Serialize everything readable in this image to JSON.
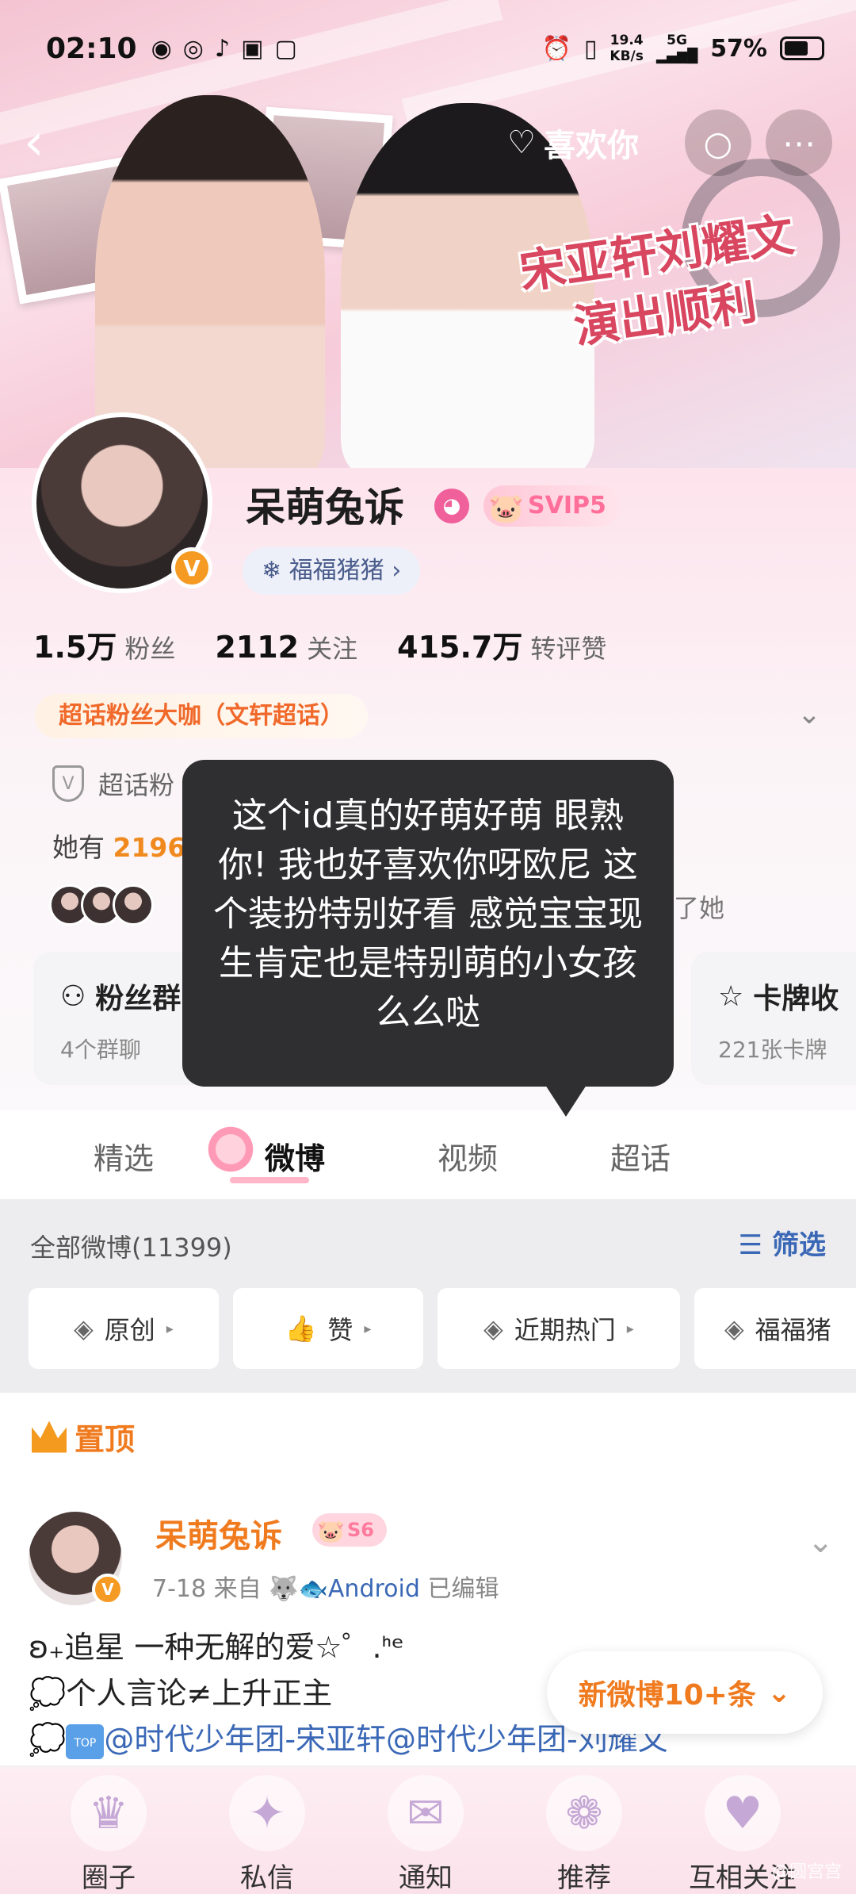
{
  "status_bar": {
    "time": "02:10",
    "net_speed": "19.4",
    "net_unit": "KB/s",
    "network": "5G",
    "battery": "57%"
  },
  "header": {
    "like_label": "喜欢你"
  },
  "banner": {
    "title_line1": "宋亚轩刘耀文",
    "title_line2": "演出顺利"
  },
  "profile": {
    "nickname": "呆萌兔诉",
    "vip_badge": "SVIP5",
    "tag": "福福猪猪",
    "stats": [
      {
        "value": "1.5万",
        "label": "粉丝"
      },
      {
        "value": "2112",
        "label": "关注"
      },
      {
        "value": "415.7万",
        "label": "转评赞"
      }
    ],
    "super_badge": "超话粉丝大咖（文轩超话）",
    "verify_text": "超话粉",
    "has_prefix": "她有",
    "has_count": "2196",
    "friends_tail": "了她"
  },
  "cards": [
    {
      "title": "粉丝群",
      "sub": "4个群聊"
    },
    {
      "title": "卡牌收",
      "sub": "221张卡牌"
    }
  ],
  "tooltip": {
    "text": "这个id真的好萌好萌 眼熟你! 我也好喜欢你呀欧尼 这个装扮特别好看 感觉宝宝现生肯定也是特别萌的小女孩 么么哒"
  },
  "tabs": [
    "精选",
    "微博",
    "视频",
    "超话"
  ],
  "filter": {
    "all_label": "全部微博(11399)",
    "filter_label": "筛选",
    "chips": [
      "原创",
      "赞",
      "近期热门",
      "福福猪"
    ]
  },
  "feed": {
    "pinned_label": "置顶",
    "post": {
      "author": "呆萌兔诉",
      "level": "S6",
      "date": "7-18",
      "from": "来自",
      "device": "Android",
      "edited": "已编辑",
      "line1": "ʚ₊追星 一种无解的爱☆゜.ᑋᵉ",
      "line2": "个人言论≠上升正主",
      "line3_at1": "@时代少年团-宋亚轩",
      "line3_at2": "@时代少年团-刘耀文"
    }
  },
  "new_posts": "新微博10+条",
  "bottom_nav": [
    "圈子",
    "私信",
    "通知",
    "推荐",
    "互相关注"
  ],
  "watermark": "@圆宫宫"
}
